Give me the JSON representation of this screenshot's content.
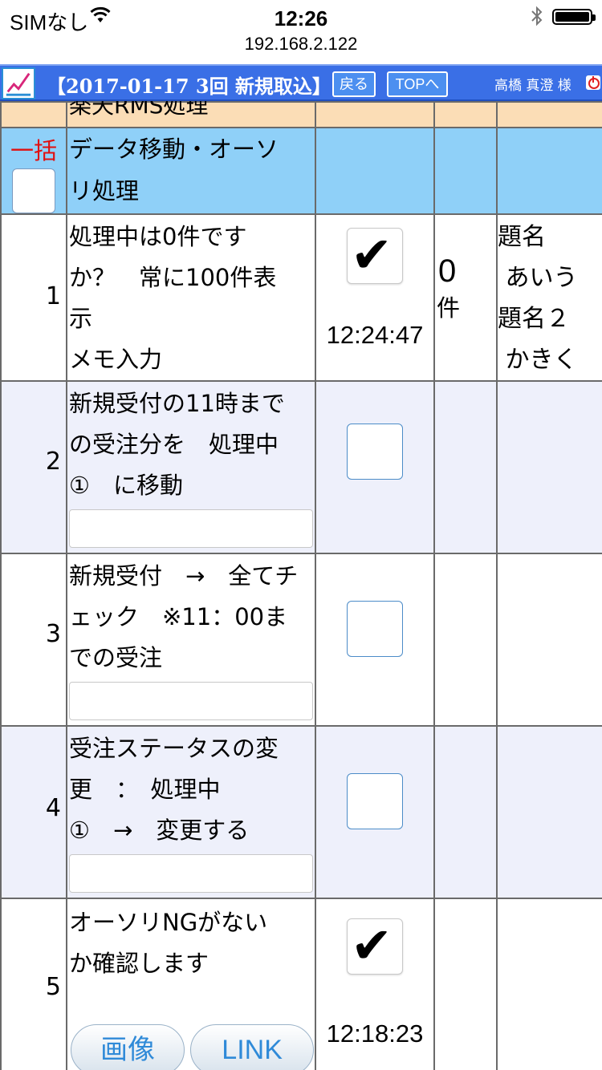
{
  "status_bar": {
    "carrier": "SIMなし",
    "time": "12:26"
  },
  "url": "192.168.2.122",
  "header": {
    "title": "【2017-01-17 3回 新規取込】",
    "back_label": "戻る",
    "top_label": "TOPへ",
    "user": "高橋 真澄 様"
  },
  "partial_row": {
    "title": "楽天RMS処理"
  },
  "bulk_row": {
    "label": "一括",
    "title_line1": "データ移動・オーソ",
    "title_line2": "リ処理"
  },
  "rows": [
    {
      "num": "1",
      "lines": [
        "処理中は0件です",
        "か？　常に100件表",
        "示",
        "メモ入力"
      ],
      "checked": true,
      "time": "12:24:47",
      "count": "0",
      "count_unit": "件",
      "memo": [
        "題名",
        " あいう",
        "題名２",
        " かきく"
      ]
    },
    {
      "num": "2",
      "lines": [
        "新規受付の11時まで",
        "の受注分を　処理中",
        "①　に移動"
      ],
      "checked": false
    },
    {
      "num": "3",
      "lines": [
        "新規受付　→　全てチ",
        "ェック　※11：00ま",
        "での受注"
      ],
      "checked": false
    },
    {
      "num": "4",
      "lines": [
        "受注ステータスの変",
        "更　：　処理中",
        "①　→　変更する"
      ],
      "checked": false
    },
    {
      "num": "5",
      "lines": [
        "オーソリNGがない",
        "か確認します"
      ],
      "checked": true,
      "time": "12:18:23",
      "image_btn": "画像",
      "link_btn": "LINK"
    }
  ],
  "colors": {
    "header_bg": "#3a6fe6",
    "partial_row_bg": "#fbddb6",
    "bulk_row_bg": "#8fd0f8",
    "alt_row_bg": "#eef0fb",
    "bulk_label": "#e01010",
    "link_text": "#2f8ad8"
  },
  "icons": {
    "wifi": "wifi-icon",
    "bluetooth": "bluetooth-icon",
    "battery": "battery-icon",
    "logo": "app-logo-icon",
    "power": "power-icon",
    "check": "checkmark-icon"
  }
}
